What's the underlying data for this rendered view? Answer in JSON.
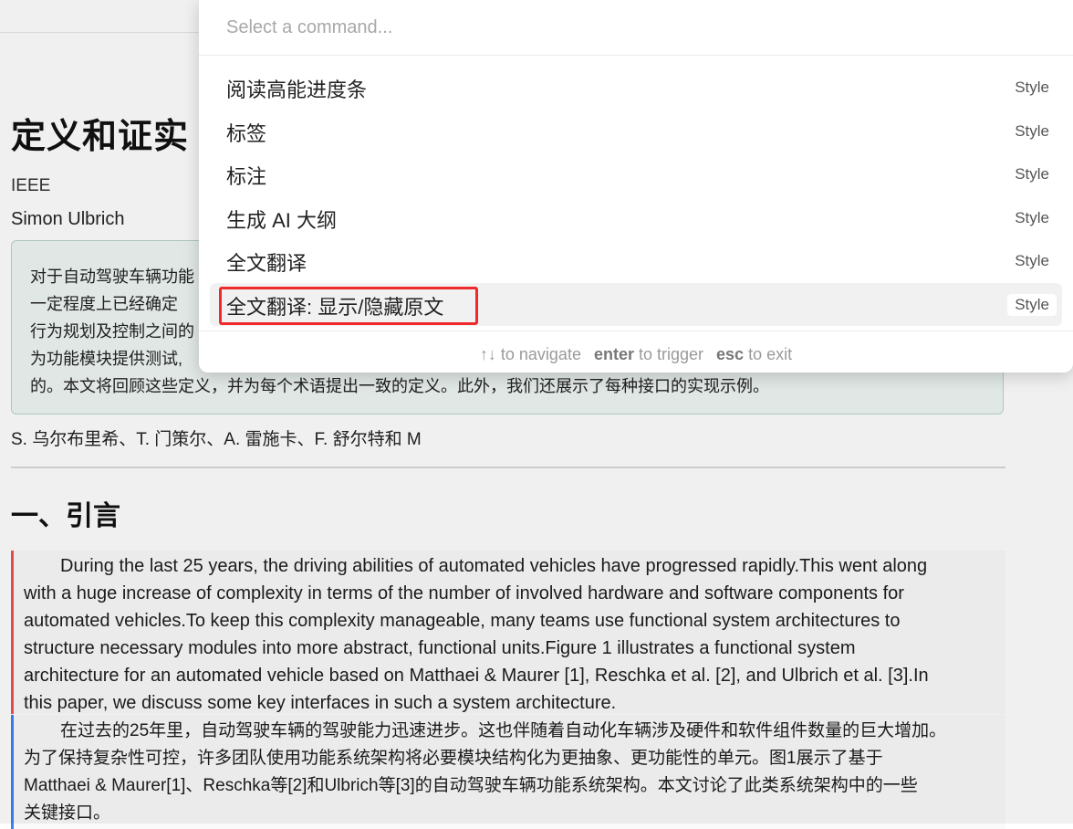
{
  "document": {
    "title": "定义和证实",
    "journal": "IEEE",
    "author": "Simon Ulbrich",
    "abstract_lines": [
      "对于自动驾驶车辆功能",
      "一定程度上已经确定",
      "行为规划及控制之间的",
      "为功能模块提供测试,",
      "的。本文将回顾这些定义，并为每个术语提出一致的定义。此外，我们还展示了每种接口的实现示例。"
    ],
    "authors_zh": "S. 乌尔布里希、T. 门策尔、A. 雷施卡、F. 舒尔特和 M",
    "section_heading": "一、引言",
    "paragraph_en_lines": [
      "During the last 25 years, the driving abilities of automated vehicles have progressed rapidly.This went along",
      "with a huge increase of complexity in terms of the number of involved hardware and software components for",
      "automated vehicles.To keep this complexity manageable, many teams use functional system architectures to",
      "structure necessary modules into more abstract, functional units.Figure 1 illustrates a functional system",
      "architecture for an automated vehicle based on Matthaei & Maurer [1], Reschka et al. [2], and Ulbrich et al. [3].In",
      "this paper, we discuss some key interfaces in such a system architecture."
    ],
    "paragraph_zh_lines": [
      "在过去的25年里，自动驾驶车辆的驾驶能力迅速进步。这也伴随着自动化车辆涉及硬件和软件组件数量的巨大增加。",
      "为了保持复杂性可控，许多团队使用功能系统架构将必要模块结构化为更抽象、更功能性的单元。图1展示了基于",
      "Matthaei & Maurer[1]、Reschka等[2]和Ulbrich等[3]的自动驾驶车辆功能系统架构。本文讨论了此类系统架构中的一些",
      "关键接口。"
    ]
  },
  "palette": {
    "placeholder": "Select a command...",
    "items": [
      {
        "label": "阅读高能进度条",
        "tag": "Style"
      },
      {
        "label": "标签",
        "tag": "Style"
      },
      {
        "label": "标注",
        "tag": "Style"
      },
      {
        "label": "生成 AI 大纲",
        "tag": "Style"
      },
      {
        "label": "全文翻译",
        "tag": "Style"
      },
      {
        "label": "全文翻译: 显示/隐藏原文",
        "tag": "Style",
        "selected": true
      }
    ],
    "footer": {
      "navigate_keys": "↑↓",
      "navigate_text": " to navigate",
      "trigger_key": "enter",
      "trigger_text": " to trigger",
      "exit_key": "esc",
      "exit_text": " to exit"
    }
  },
  "colors": {
    "highlight_border": "#ee2a2a",
    "en_bar": "#f05252",
    "zh_bar": "#3b82f6",
    "abstract_bg": "#eef6f4"
  }
}
